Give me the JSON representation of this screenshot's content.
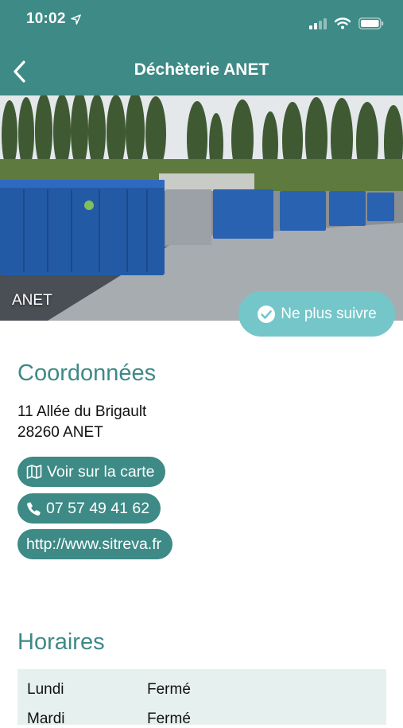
{
  "status_bar": {
    "time": "10:02"
  },
  "header": {
    "title": "Déchèterie ANET",
    "back_icon": "chevron-left-icon"
  },
  "hero": {
    "caption": "ANET"
  },
  "follow_button": {
    "label": "Ne plus suivre",
    "icon": "check-circle-icon"
  },
  "contact": {
    "title": "Coordonnées",
    "address_line1": "11 Allée du Brigault",
    "address_line2": "28260 ANET",
    "map_label": "Voir sur la carte",
    "phone": "07 57 49 41 62",
    "website": "http://www.sitreva.fr"
  },
  "hours": {
    "title": "Horaires",
    "rows": [
      {
        "day": "Lundi",
        "value": "Fermé"
      },
      {
        "day": "Mardi",
        "value": "Fermé"
      }
    ]
  },
  "colors": {
    "primary": "#3d8a86",
    "follow": "#74c6c9",
    "hours_bg": "#e6f1ef"
  }
}
